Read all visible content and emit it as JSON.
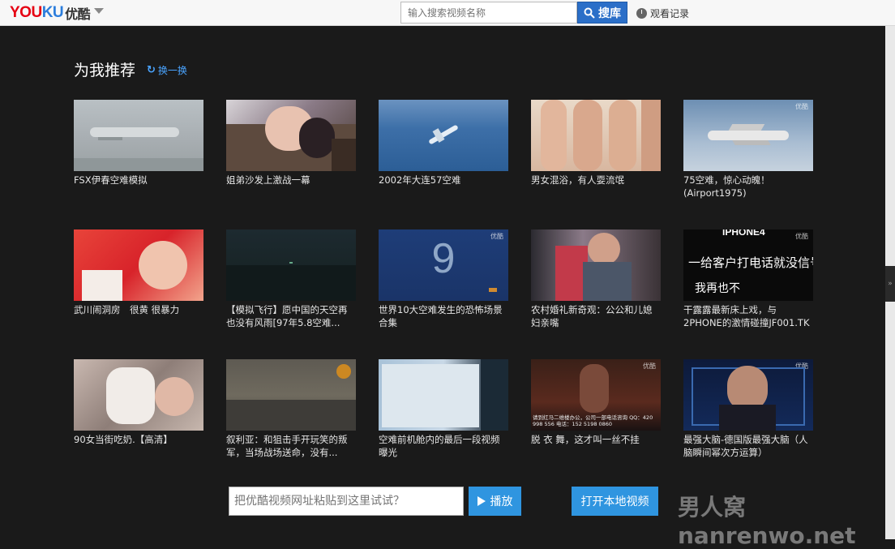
{
  "header": {
    "logo_text_a": "YOU",
    "logo_text_b": "KU",
    "logo_text_cn": "优酷",
    "search_placeholder": "输入搜索视频名称",
    "search_button": "搜库",
    "history": "观看记录"
  },
  "recommend": {
    "title": "为我推荐",
    "refresh": "换一换",
    "videos": [
      {
        "title": "FSX伊春空难模拟"
      },
      {
        "title": "姐弟沙发上激战一幕"
      },
      {
        "title": "2002年大连57空难"
      },
      {
        "title": "男女混浴，有人耍流氓"
      },
      {
        "title": "75空难，惊心动魄！(Airport1975)"
      },
      {
        "title": "武川闹洞房　很黄 很暴力"
      },
      {
        "title": "【模拟飞行】愿中国的天空再也没有风雨[97年5.8空难..."
      },
      {
        "title": "世界10大空难发生的恐怖场景合集"
      },
      {
        "title": "农村婚礼新奇观：公公和儿媳妇亲嘴"
      },
      {
        "title": "干露露最新床上戏，与2PHONE的激情碰撞JF001.TK"
      },
      {
        "title": "90女当街吃奶.【高清】"
      },
      {
        "title": "叙利亚：和狙击手开玩笑的叛军，当场战场送命，没有..."
      },
      {
        "title": "空难前机舱内的最后一段视频曝光"
      },
      {
        "title": "脱 衣 舞，这才叫一丝不挂"
      },
      {
        "title": "最强大脑-德国版最强大脑（人脑瞬间幂次方运算）"
      }
    ]
  },
  "thumb_text": {
    "t4_wm": "优酷",
    "t7_number": "9",
    "t7_wm": "优酷",
    "t9_line1": "IPHONE4",
    "t9_line2": "一给客户打电话就没信号",
    "t9_line3": "我再也不",
    "t9_wm": "优酷",
    "t13_wm": "优酷",
    "t13_caption": "请到红马二维楼办公，公司一部电话咨询  QQ：420 998 556 电话：152 5198 0860",
    "t14_wm": "优酷"
  },
  "bottom": {
    "url_placeholder": "把优酷视频网址粘贴到这里试试？",
    "play_button": "播放",
    "local_button": "打开本地视频"
  },
  "watermark": "男人窝nanrenwo.net"
}
